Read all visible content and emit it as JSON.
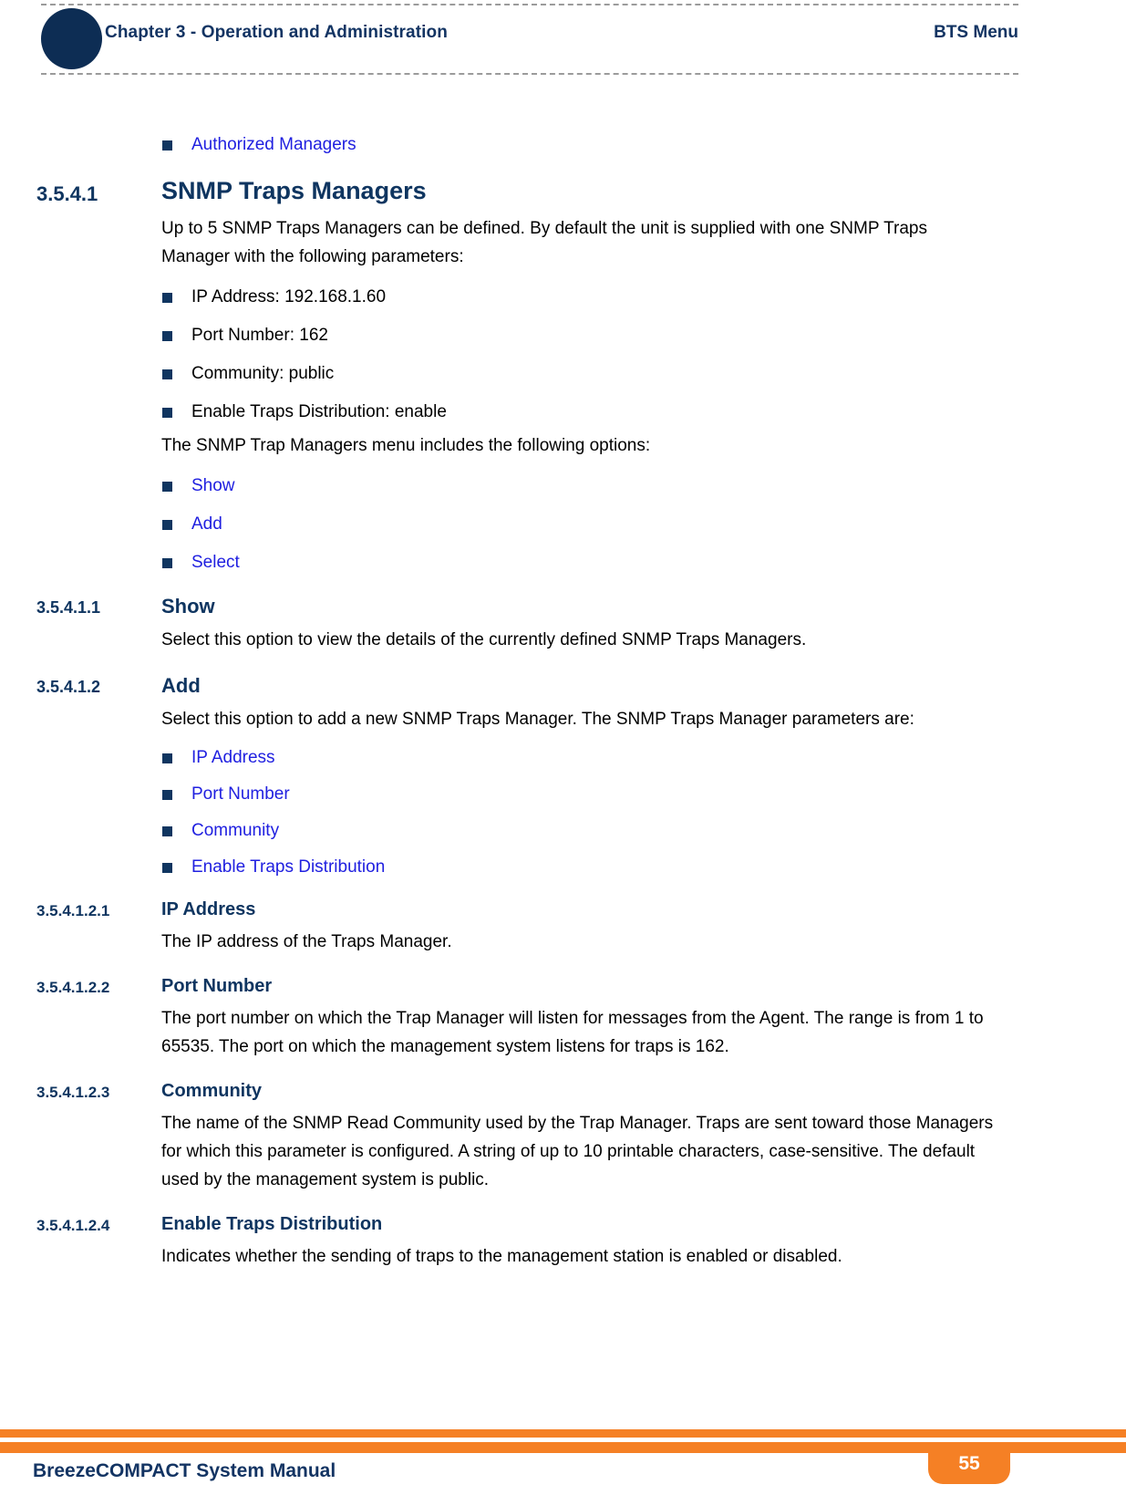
{
  "header": {
    "chapter": "Chapter 3 - Operation and Administration",
    "section": "BTS Menu"
  },
  "lead_link": "Authorized Managers",
  "sections": [
    {
      "number": "3.5.4.1",
      "title": "SNMP Traps Managers",
      "paragraph1": "Up to 5 SNMP Traps Managers can be defined. By default the unit is supplied with one SNMP Traps Manager with the following parameters:",
      "defaults": [
        "IP Address: 192.168.1.60",
        "Port Number: 162",
        "Community: public",
        "Enable Traps Distribution: enable"
      ],
      "paragraph2": "The SNMP Trap Managers menu includes the following options:",
      "options": [
        "Show",
        "Add",
        "Select"
      ]
    },
    {
      "number": "3.5.4.1.1",
      "title": "Show",
      "paragraph": "Select this option to view the details of the currently defined SNMP Traps Managers."
    },
    {
      "number": "3.5.4.1.2",
      "title": "Add",
      "paragraph": "Select this option to add a new SNMP Traps Manager. The SNMP Traps Manager parameters are:",
      "params": [
        "IP Address",
        "Port Number",
        "Community",
        "Enable Traps Distribution"
      ]
    },
    {
      "number": "3.5.4.1.2.1",
      "title": "IP Address",
      "paragraph": "The IP address of the Traps Manager."
    },
    {
      "number": "3.5.4.1.2.2",
      "title": "Port Number",
      "paragraph": "The port number on which the Trap Manager will listen for messages from the Agent. The range is from 1 to 65535. The port on which the management system listens for traps is 162."
    },
    {
      "number": "3.5.4.1.2.3",
      "title": "Community",
      "paragraph": "The name of the SNMP Read Community used by the Trap Manager. Traps are sent toward those Managers for which this parameter is configured. A string of up to 10 printable characters, case-sensitive. The default used by the management system is public."
    },
    {
      "number": "3.5.4.1.2.4",
      "title": "Enable Traps Distribution",
      "paragraph": "Indicates whether the sending of traps to the management station is enabled or disabled."
    }
  ],
  "footer": {
    "manual_title": "BreezeCOMPACT System Manual",
    "page_number": "55"
  },
  "colors": {
    "navy": "#0f3560",
    "header_navy": "#133463",
    "link_blue": "#2020e0",
    "orange": "#f58025",
    "dot_navy": "#0d2d54"
  }
}
